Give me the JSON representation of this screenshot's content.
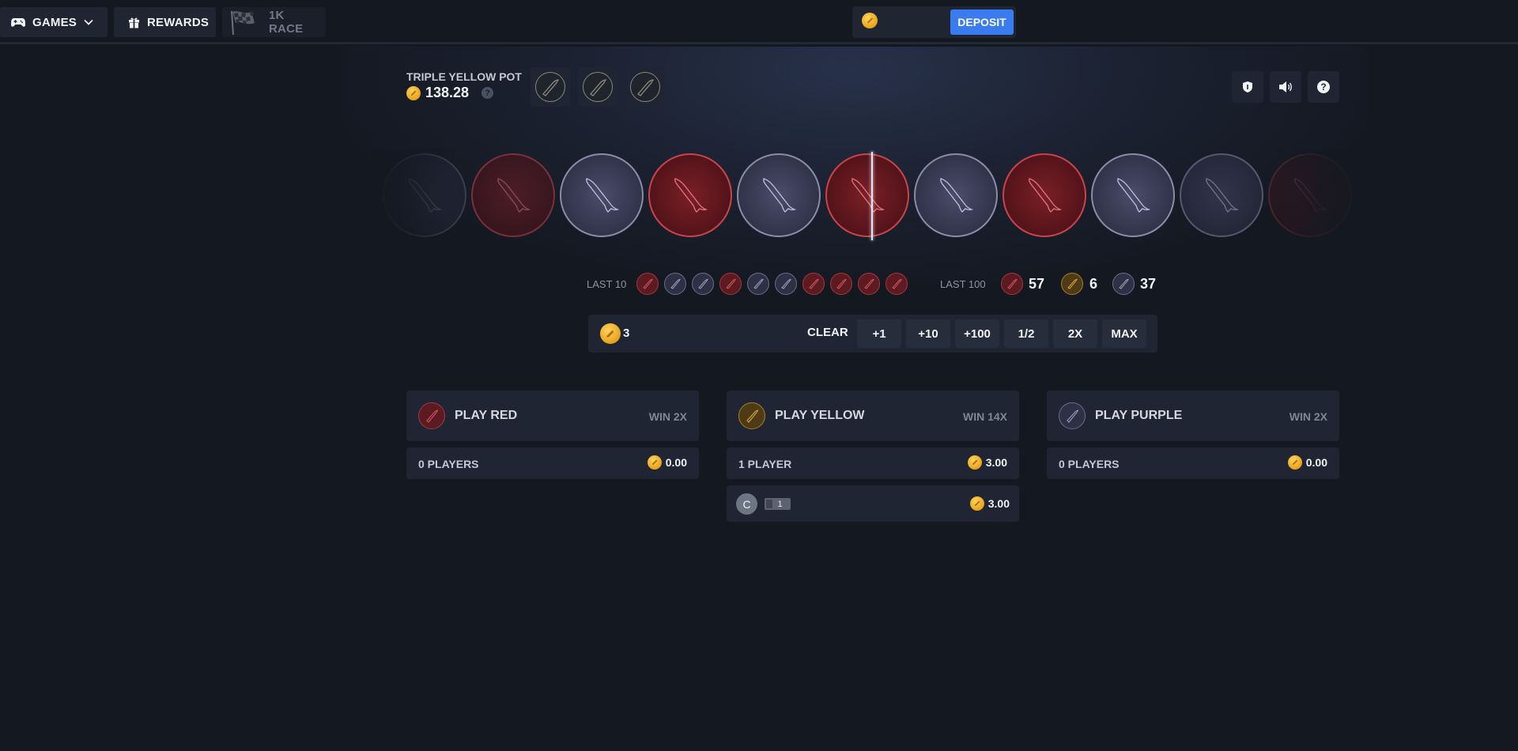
{
  "nav": {
    "games_label": "GAMES",
    "rewards_label": "REWARDS",
    "race_label": "1K RACE"
  },
  "wallet": {
    "deposit_label": "DEPOSIT"
  },
  "pot": {
    "label": "TRIPLE YELLOW POT",
    "value": "138.28",
    "help": "?"
  },
  "wheel": {
    "items": [
      "purple",
      "red",
      "purple",
      "red",
      "purple",
      "red",
      "purple",
      "red",
      "purple",
      "purple",
      "red"
    ]
  },
  "history": {
    "last10_label": "LAST 10",
    "last10": [
      "red",
      "purple",
      "purple",
      "red",
      "purple",
      "purple",
      "red",
      "red",
      "red",
      "red"
    ],
    "last100_label": "LAST 100",
    "last100": {
      "red": "57",
      "yellow": "6",
      "purple": "37"
    }
  },
  "bet": {
    "amount": "3",
    "clear_label": "CLEAR",
    "buttons": [
      "+1",
      "+10",
      "+100",
      "1/2",
      "2X",
      "MAX"
    ]
  },
  "panels": [
    {
      "color": "red",
      "title": "PLAY RED",
      "win": "WIN 2X",
      "players": "0 PLAYERS",
      "total": "0.00"
    },
    {
      "color": "yellow",
      "title": "PLAY YELLOW",
      "win": "WIN 14X",
      "players": "1 PLAYER",
      "total": "3.00"
    },
    {
      "color": "purple",
      "title": "PLAY PURPLE",
      "win": "WIN 2X",
      "players": "0 PLAYERS",
      "total": "0.00"
    }
  ],
  "yellow_players": [
    {
      "avatar_initial": "C",
      "level": "1",
      "bet": "3.00"
    }
  ],
  "colors": {
    "background": "#141821",
    "panel": "#1f2533",
    "deposit": "#3a7bf0",
    "red": "#c9434b",
    "purple": "#8a8ca8",
    "yellow": "#e8a21c"
  }
}
